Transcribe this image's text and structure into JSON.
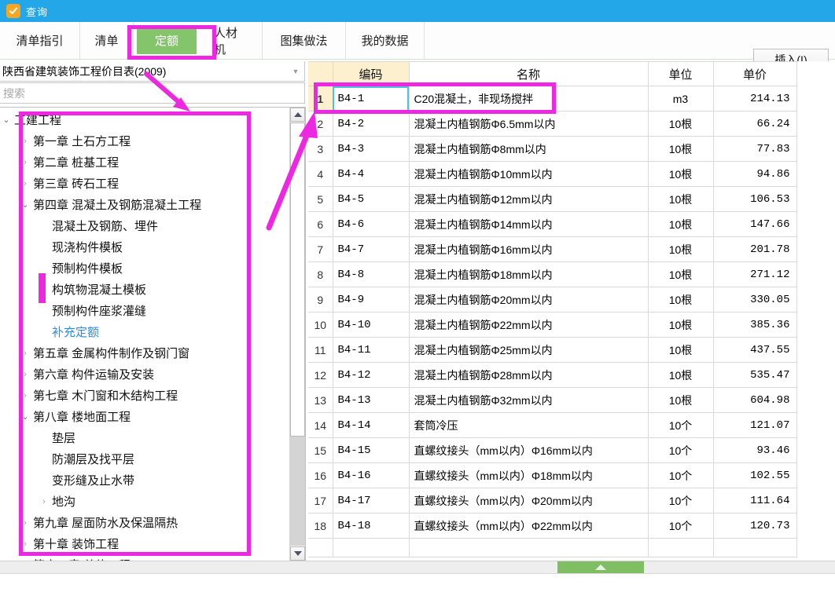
{
  "window": {
    "title": "查询",
    "icon": "app-check-icon",
    "titlebar_color": "#24a7e8"
  },
  "tabs": [
    {
      "label": "清单指引",
      "selected": false
    },
    {
      "label": "清单",
      "selected": false
    },
    {
      "label": "定额",
      "selected": true
    },
    {
      "label": "人材机",
      "selected": false
    },
    {
      "label": "图集做法",
      "selected": false
    },
    {
      "label": "我的数据",
      "selected": false
    }
  ],
  "toolbar": {
    "insert_label": "插入(I)"
  },
  "left_panel": {
    "catalog_selected": "陕西省建筑装饰工程价目表(2009)",
    "catalog_caret": "chevron-down-icon",
    "search_placeholder": "搜索",
    "tree": [
      {
        "label": "工建工程",
        "indent": 0,
        "state": "open",
        "link": false
      },
      {
        "label": "第一章 土石方工程",
        "indent": 1,
        "state": "closed",
        "link": false
      },
      {
        "label": "第二章 桩基工程",
        "indent": 1,
        "state": "closed",
        "link": false
      },
      {
        "label": "第三章 砖石工程",
        "indent": 1,
        "state": "closed",
        "link": false
      },
      {
        "label": "第四章 混凝土及钢筋混凝土工程",
        "indent": 1,
        "state": "open",
        "link": false
      },
      {
        "label": "混凝土及钢筋、埋件",
        "indent": 2,
        "state": "leaf",
        "link": false
      },
      {
        "label": "现浇构件模板",
        "indent": 2,
        "state": "leaf",
        "link": false
      },
      {
        "label": "预制构件模板",
        "indent": 2,
        "state": "leaf",
        "link": false
      },
      {
        "label": "构筑物混凝土模板",
        "indent": 2,
        "state": "closed",
        "link": false
      },
      {
        "label": "预制构件座浆灌缝",
        "indent": 2,
        "state": "leaf",
        "link": false
      },
      {
        "label": "补充定额",
        "indent": 2,
        "state": "leaf",
        "link": true
      },
      {
        "label": "第五章 金属构件制作及钢门窗",
        "indent": 1,
        "state": "closed",
        "link": false
      },
      {
        "label": "第六章 构件运输及安装",
        "indent": 1,
        "state": "closed",
        "link": false
      },
      {
        "label": "第七章 木门窗和木结构工程",
        "indent": 1,
        "state": "closed",
        "link": false
      },
      {
        "label": "第八章 楼地面工程",
        "indent": 1,
        "state": "open",
        "link": false
      },
      {
        "label": "垫层",
        "indent": 2,
        "state": "leaf",
        "link": false
      },
      {
        "label": "防潮层及找平层",
        "indent": 2,
        "state": "leaf",
        "link": false
      },
      {
        "label": "变形缝及止水带",
        "indent": 2,
        "state": "leaf",
        "link": false
      },
      {
        "label": "地沟",
        "indent": 2,
        "state": "closed",
        "link": false
      },
      {
        "label": "第九章 屋面防水及保温隔热",
        "indent": 1,
        "state": "closed",
        "link": false
      },
      {
        "label": "第十章 装饰工程",
        "indent": 1,
        "state": "closed",
        "link": false
      },
      {
        "label": "第十一章 总体工程",
        "indent": 1,
        "state": "closed",
        "link": false
      }
    ]
  },
  "grid": {
    "columns": [
      "",
      "编码",
      "名称",
      "单位",
      "单价"
    ],
    "rows": [
      {
        "n": "1",
        "code": "B4-1",
        "name": "C20混凝土，非现场搅拌",
        "unit": "m3",
        "price": "214.13",
        "selected": true
      },
      {
        "n": "2",
        "code": "B4-2",
        "name": "混凝土内植钢筋Φ6.5mm以内",
        "unit": "10根",
        "price": "66.24",
        "selected": false
      },
      {
        "n": "3",
        "code": "B4-3",
        "name": "混凝土内植钢筋Φ8mm以内",
        "unit": "10根",
        "price": "77.83",
        "selected": false
      },
      {
        "n": "4",
        "code": "B4-4",
        "name": "混凝土内植钢筋Φ10mm以内",
        "unit": "10根",
        "price": "94.86",
        "selected": false
      },
      {
        "n": "5",
        "code": "B4-5",
        "name": "混凝土内植钢筋Φ12mm以内",
        "unit": "10根",
        "price": "106.53",
        "selected": false
      },
      {
        "n": "6",
        "code": "B4-6",
        "name": "混凝土内植钢筋Φ14mm以内",
        "unit": "10根",
        "price": "147.66",
        "selected": false
      },
      {
        "n": "7",
        "code": "B4-7",
        "name": "混凝土内植钢筋Φ16mm以内",
        "unit": "10根",
        "price": "201.78",
        "selected": false
      },
      {
        "n": "8",
        "code": "B4-8",
        "name": "混凝土内植钢筋Φ18mm以内",
        "unit": "10根",
        "price": "271.12",
        "selected": false
      },
      {
        "n": "9",
        "code": "B4-9",
        "name": "混凝土内植钢筋Φ20mm以内",
        "unit": "10根",
        "price": "330.05",
        "selected": false
      },
      {
        "n": "10",
        "code": "B4-10",
        "name": "混凝土内植钢筋Φ22mm以内",
        "unit": "10根",
        "price": "385.36",
        "selected": false
      },
      {
        "n": "11",
        "code": "B4-11",
        "name": "混凝土内植钢筋Φ25mm以内",
        "unit": "10根",
        "price": "437.55",
        "selected": false
      },
      {
        "n": "12",
        "code": "B4-12",
        "name": "混凝土内植钢筋Φ28mm以内",
        "unit": "10根",
        "price": "535.47",
        "selected": false
      },
      {
        "n": "13",
        "code": "B4-13",
        "name": "混凝土内植钢筋Φ32mm以内",
        "unit": "10根",
        "price": "604.98",
        "selected": false
      },
      {
        "n": "14",
        "code": "B4-14",
        "name": "套筒冷压",
        "unit": "10个",
        "price": "121.07",
        "selected": false
      },
      {
        "n": "15",
        "code": "B4-15",
        "name": "直螺纹接头（mm以内）Φ16mm以内",
        "unit": "10个",
        "price": "93.46",
        "selected": false
      },
      {
        "n": "16",
        "code": "B4-16",
        "name": "直螺纹接头（mm以内）Φ18mm以内",
        "unit": "10个",
        "price": "102.55",
        "selected": false
      },
      {
        "n": "17",
        "code": "B4-17",
        "name": "直螺纹接头（mm以内）Φ20mm以内",
        "unit": "10个",
        "price": "111.64",
        "selected": false
      },
      {
        "n": "18",
        "code": "B4-18",
        "name": "直螺纹接头（mm以内）Φ22mm以内",
        "unit": "10个",
        "price": "120.73",
        "selected": false
      }
    ]
  },
  "annotation": {
    "color": "#ec29e0",
    "marks": [
      "tab-highlight-box",
      "tree-highlight-box",
      "row-highlight-box",
      "arrow-to-search",
      "arrow-to-row",
      "tree-item-bar"
    ]
  }
}
